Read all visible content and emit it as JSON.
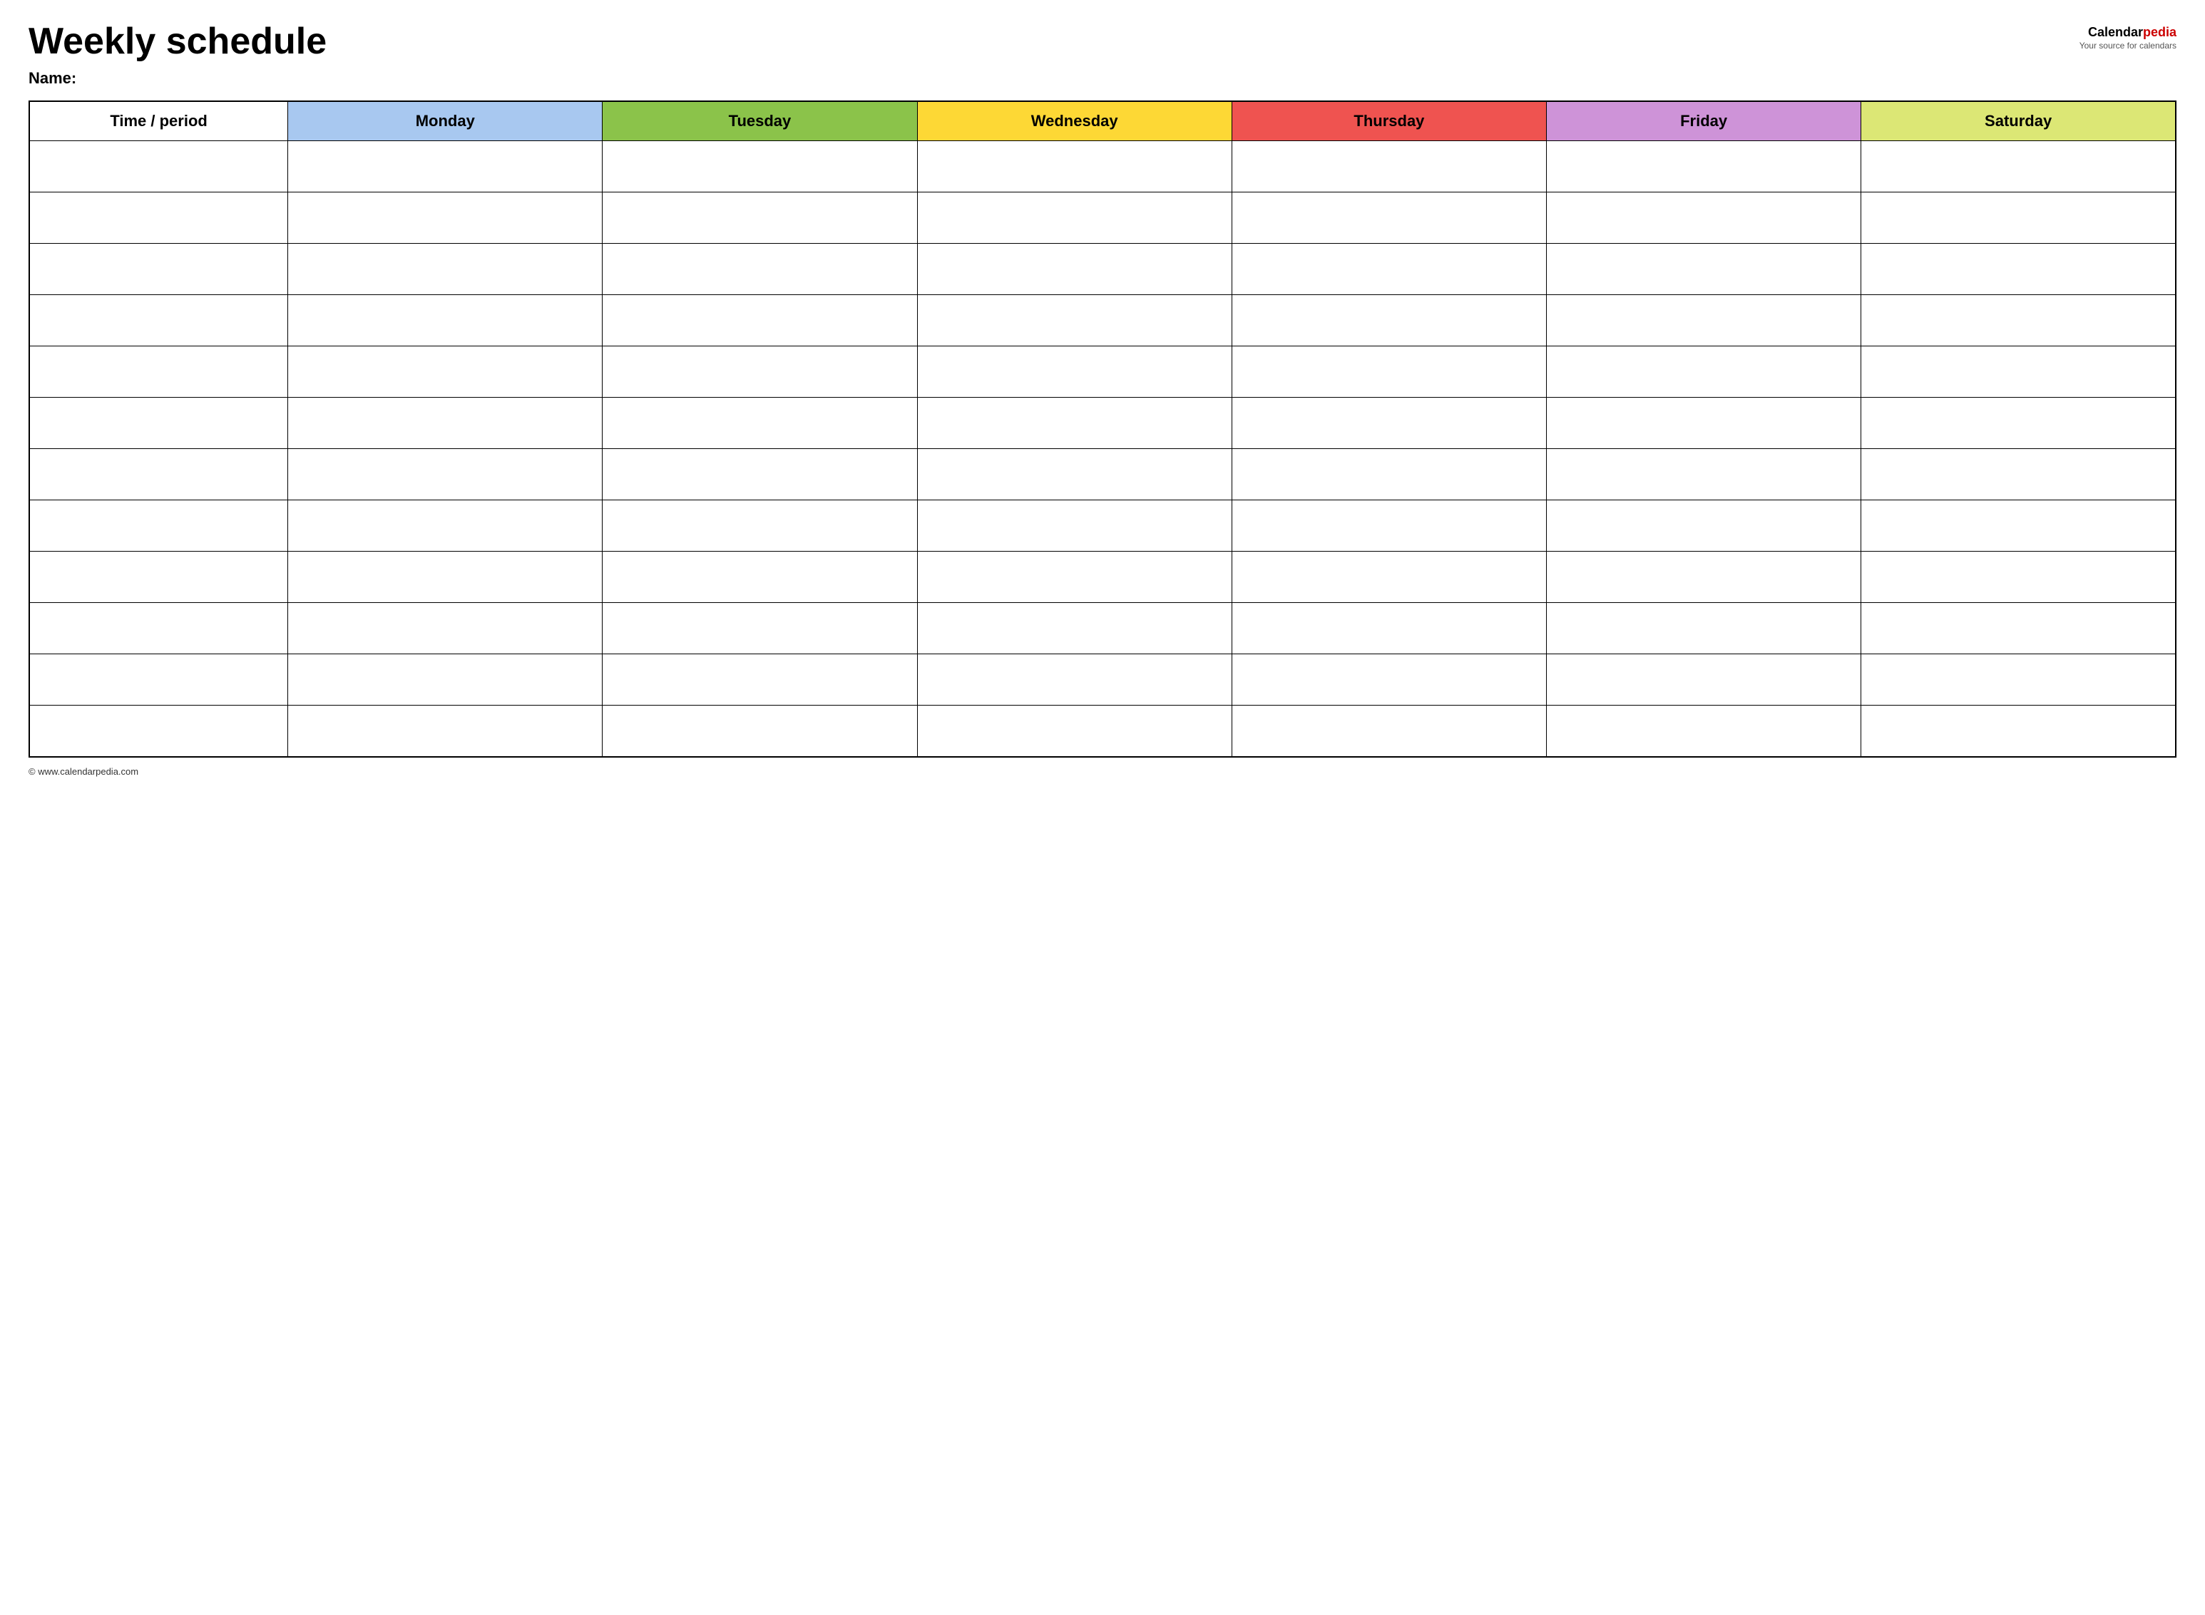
{
  "header": {
    "title": "Weekly schedule",
    "logo_calendar": "Calendar",
    "logo_pedia": "pedia",
    "logo_tagline": "Your source for calendars"
  },
  "name_label": "Name:",
  "columns": [
    {
      "key": "time",
      "label": "Time / period",
      "color_class": "col-time"
    },
    {
      "key": "monday",
      "label": "Monday",
      "color_class": "col-monday"
    },
    {
      "key": "tuesday",
      "label": "Tuesday",
      "color_class": "col-tuesday"
    },
    {
      "key": "wednesday",
      "label": "Wednesday",
      "color_class": "col-wednesday"
    },
    {
      "key": "thursday",
      "label": "Thursday",
      "color_class": "col-thursday"
    },
    {
      "key": "friday",
      "label": "Friday",
      "color_class": "col-friday"
    },
    {
      "key": "saturday",
      "label": "Saturday",
      "color_class": "col-saturday"
    }
  ],
  "row_count": 12,
  "footer": {
    "url": "© www.calendarpedia.com"
  }
}
